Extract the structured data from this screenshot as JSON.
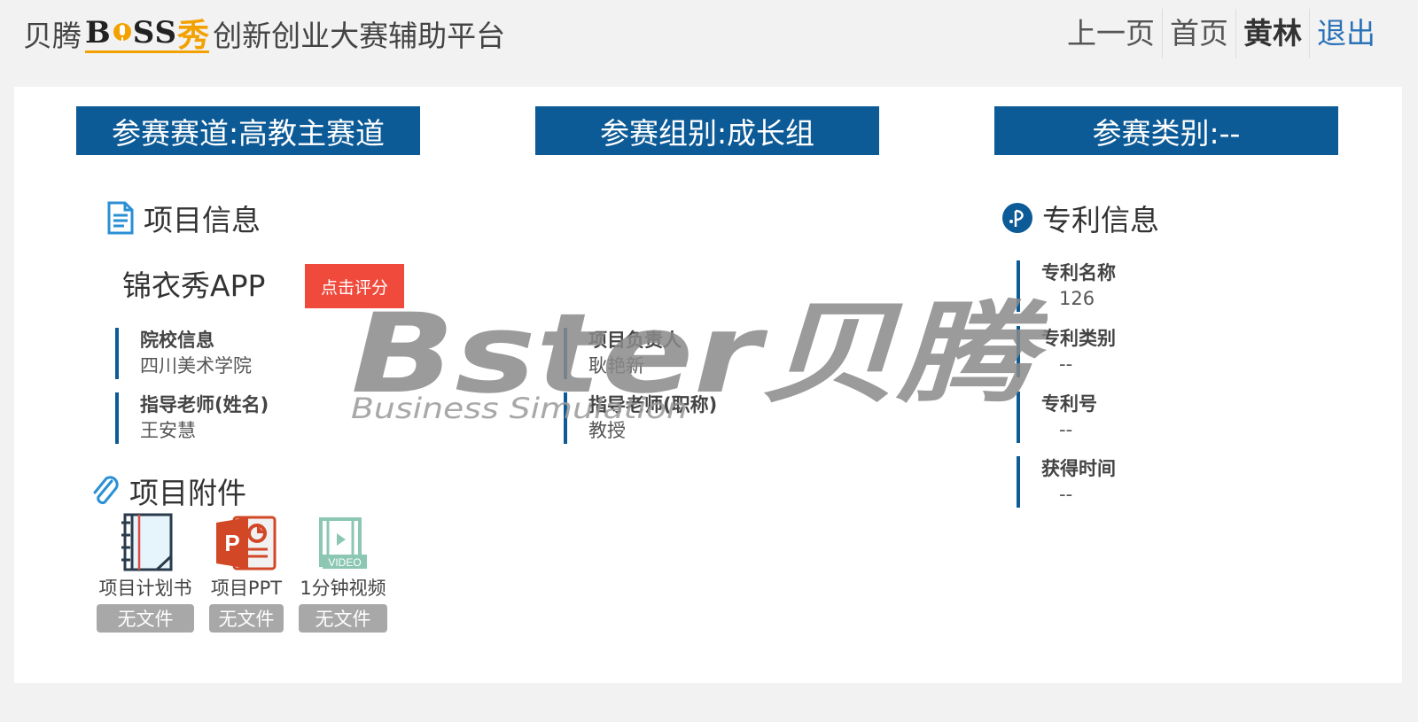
{
  "header": {
    "brand_prefix": "贝腾",
    "brand_logo": "BOSS秀",
    "brand_suffix": "创新创业大赛辅助平台",
    "nav": {
      "prev": "上一页",
      "home": "首页",
      "user": "黄林",
      "logout": "退出"
    }
  },
  "banners": {
    "track": "参赛赛道:高教主赛道",
    "group": "参赛组别:成长组",
    "category": "参赛类别:--"
  },
  "project": {
    "section_title": "项目信息",
    "name": "锦衣秀APP",
    "rate_button": "点击评分",
    "school_label": "院校信息",
    "school_value": "四川美术学院",
    "leader_label": "项目负责人",
    "leader_value": "耿艳新",
    "teacher_label": "指导老师(姓名)",
    "teacher_value": "王安慧",
    "teacher_title_label": "指导老师(职称)",
    "teacher_title_value": "教授"
  },
  "patent": {
    "section_title": "专利信息",
    "name_label": "专利名称",
    "name_value": "126",
    "type_label": "专利类别",
    "type_value": "--",
    "number_label": "专利号",
    "number_value": "--",
    "date_label": "获得时间",
    "date_value": "--"
  },
  "attachments": {
    "section_title": "项目附件",
    "items": [
      {
        "label": "项目计划书",
        "status": "无文件",
        "icon": "notebook-icon"
      },
      {
        "label": "项目PPT",
        "status": "无文件",
        "icon": "powerpoint-icon"
      },
      {
        "label": "1分钟视频",
        "status": "无文件",
        "icon": "video-icon"
      }
    ]
  },
  "watermark": {
    "main": "Bster贝腾",
    "sub": "Business Simulation"
  },
  "colors": {
    "banner": "#0c5a96",
    "rate_button": "#f04a3c",
    "logo_accent": "#f3a100",
    "link": "#2b72b8"
  }
}
